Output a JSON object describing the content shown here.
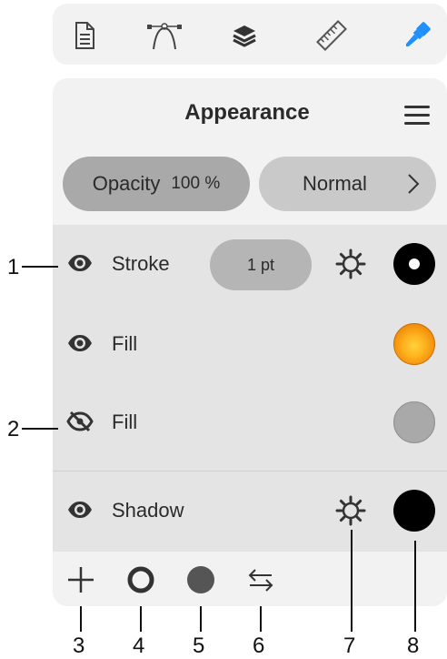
{
  "toolbar": {
    "icons": [
      "document-icon",
      "bezier-pen-icon",
      "layers-icon",
      "ruler-icon",
      "brush-icon"
    ],
    "active_color": "#1e90ff"
  },
  "panel": {
    "title": "Appearance",
    "opacity_label": "Opacity",
    "opacity_value": "100 %",
    "blend_mode": "Normal"
  },
  "rows": [
    {
      "label": "Stroke",
      "visible": true,
      "width": "1 pt",
      "swatch": "#000000"
    },
    {
      "label": "Fill",
      "visible": true,
      "swatch": "#f5a01a"
    },
    {
      "label": "Fill",
      "visible": false,
      "swatch": "#a9a9a9"
    },
    {
      "label": "Shadow",
      "visible": true,
      "swatch": "#000000"
    }
  ],
  "bottom_bar": {
    "icons": [
      "add-icon",
      "add-stroke-icon",
      "add-fill-icon",
      "swap-icon"
    ]
  },
  "callouts": [
    "1",
    "2",
    "3",
    "4",
    "5",
    "6",
    "7",
    "8"
  ]
}
